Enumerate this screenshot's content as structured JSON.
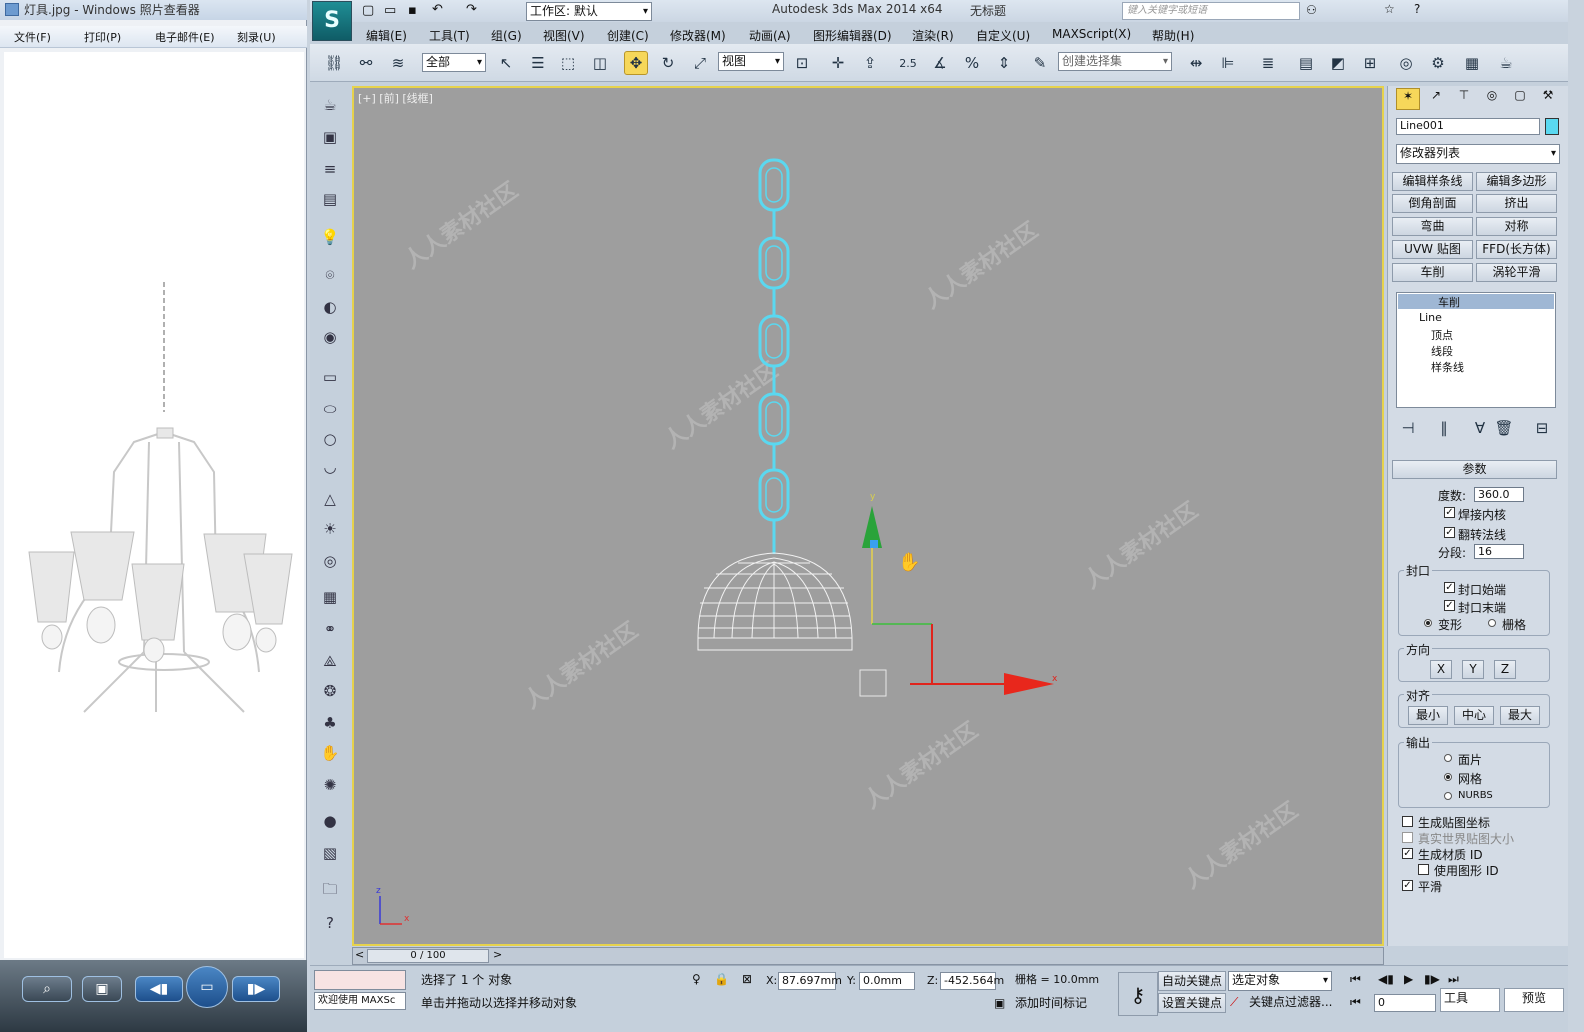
{
  "photo_viewer": {
    "title": "灯具.jpg - Windows 照片查看器",
    "menu": [
      "文件(F)",
      "打印(P)",
      "电子邮件(E)",
      "刻录(U)"
    ]
  },
  "max": {
    "title": "Autodesk 3ds Max  2014 x64",
    "doc": "无标题",
    "workspace": "工作区: 默认",
    "search_placeholder": "键入关键字或短语",
    "menu": [
      "编辑(E)",
      "工具(T)",
      "组(G)",
      "视图(V)",
      "创建(C)",
      "修改器(M)",
      "动画(A)",
      "图形编辑器(D)",
      "渲染(R)",
      "自定义(U)",
      "MAXScript(X)",
      "帮助(H)"
    ],
    "filter_all": "全部",
    "ref_coord": "视图",
    "snap_value": "2.5",
    "selection_set_placeholder": "创建选择集",
    "viewport_label": "[+] [前] [线框]",
    "axis_y": "y",
    "axis_x": "x",
    "axis_z": "z",
    "object_name": "Line001",
    "modifier_list": "修改器列表",
    "modifier_buttons": [
      "编辑样条线",
      "编辑多边形",
      "倒角剖面",
      "挤出",
      "弯曲",
      "对称",
      "UVW 贴图",
      "FFD(长方体)",
      "车削",
      "涡轮平滑"
    ],
    "stack": {
      "top": "车削",
      "base": "Line",
      "subs": [
        "顶点",
        "线段",
        "样条线"
      ]
    },
    "rollout": "参数",
    "degrees_label": "度数:",
    "degrees": "360.0",
    "weld_core": "焊接内核",
    "flip_normals": "翻转法线",
    "segments_label": "分段:",
    "segments": "16",
    "capping": "封口",
    "cap_start": "封口始端",
    "cap_end": "封口末端",
    "morph": "变形",
    "grid": "栅格",
    "direction": "方向",
    "dir_buttons": [
      "X",
      "Y",
      "Z"
    ],
    "align": "对齐",
    "align_buttons": [
      "最小",
      "中心",
      "最大"
    ],
    "output": "输出",
    "out_patch": "面片",
    "out_mesh": "网格",
    "out_nurbs": "NURBS",
    "gen_map": "生成贴图坐标",
    "real_world": "真实世界贴图大小",
    "gen_mat": "生成材质 ID",
    "use_shape": "使用图形 ID",
    "smooth": "平滑",
    "timeline": "0 / 100",
    "status_selected": "选择了 1 个 对象",
    "status_hint": "单击并拖动以选择并移动对象",
    "welcome": "欢迎使用 MAXSc",
    "x_label": "X:",
    "x_val": "87.697mm",
    "y_label": "Y:",
    "y_val": "0.0mm",
    "z_label": "Z:",
    "z_val": "-452.564m",
    "grid_info": "栅格 = 10.0mm",
    "auto_key": "自动关键点",
    "set_key": "设置关键点",
    "selected_obj": "选定对象",
    "key_filter": "关键点过滤器...",
    "add_time_tag": "添加时间标记",
    "frame": "0",
    "tools_tab": "工具",
    "preview_tab": "预览"
  },
  "colors": {
    "wire": "#5ad8f0",
    "viewport": "#9e9e9e"
  }
}
